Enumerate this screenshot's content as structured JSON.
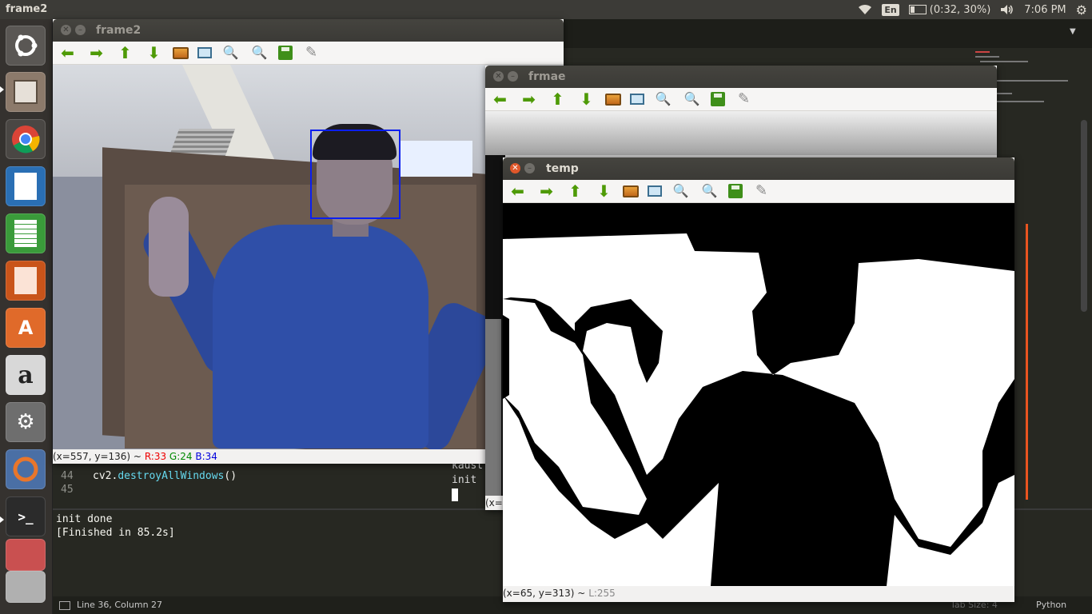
{
  "top_panel": {
    "app_title": "frame2",
    "language": "En",
    "battery": "(0:32, 30%)",
    "clock": "7:06 PM",
    "icons": [
      "wifi-icon",
      "battery-icon",
      "volume-icon",
      "settings-gear-icon"
    ]
  },
  "launcher": {
    "items": [
      {
        "name": "ubuntu-dash",
        "icon": "ubuntu-logo-icon",
        "color": "#d9501f"
      },
      {
        "name": "files",
        "icon": "file-cabinet-icon",
        "color": "#8c7a6b"
      },
      {
        "name": "chrome",
        "icon": "chrome-icon",
        "color": "#4285f4"
      },
      {
        "name": "writer",
        "icon": "document-icon",
        "color": "#2a6fb4"
      },
      {
        "name": "calc",
        "icon": "spreadsheet-icon",
        "color": "#3a9b3a"
      },
      {
        "name": "impress",
        "icon": "presentation-icon",
        "color": "#c9541a"
      },
      {
        "name": "software-center",
        "icon": "shopping-bag-icon",
        "color": "#e06a2a"
      },
      {
        "name": "amazon",
        "icon": "amazon-icon",
        "color": "#555555"
      },
      {
        "name": "system-settings",
        "icon": "wrench-gear-icon",
        "color": "#888888"
      },
      {
        "name": "updater",
        "icon": "sync-icon",
        "color": "#e9762b"
      },
      {
        "name": "terminal",
        "icon": "terminal-icon",
        "color": "#2b2b2b"
      },
      {
        "name": "workspaces",
        "icon": "stacked-apps-icon",
        "color": "#b0b0b0"
      }
    ]
  },
  "editor": {
    "code_lines": [
      {
        "number": "44",
        "prefix": "cv2.",
        "fn": "destroyAllWindows",
        "suffix": "()"
      },
      {
        "number": "45",
        "prefix": "",
        "fn": "",
        "suffix": ""
      }
    ],
    "console_lines": [
      "init done",
      "[Finished in 85.2s]"
    ],
    "terminal_lines": [
      "kaust",
      "init"
    ],
    "status": {
      "position": "Line 36, Column 27",
      "tab_size": "Tab Size: 4",
      "syntax": "Python"
    }
  },
  "windows": {
    "frame2": {
      "title": "frame2",
      "status_coords": "(x=557, y=136) ~",
      "r": "R:33",
      "g": "G:24",
      "b": "B:34"
    },
    "frmae": {
      "title": "frmae",
      "status_coords": "(x="
    },
    "temp": {
      "title": "temp",
      "status_coords": "(x=65, y=313) ~",
      "l": "L:255"
    }
  },
  "toolbar_buttons": [
    "pan-left-icon",
    "pan-right-icon",
    "pan-up-icon",
    "pan-down-icon",
    "zoom-reset-icon",
    "zoom-fit-icon",
    "zoom-in-icon",
    "zoom-out-icon",
    "save-icon",
    "properties-brush-icon"
  ],
  "colors": {
    "accent": "#e95420",
    "face_box": "#0b1ff0"
  }
}
